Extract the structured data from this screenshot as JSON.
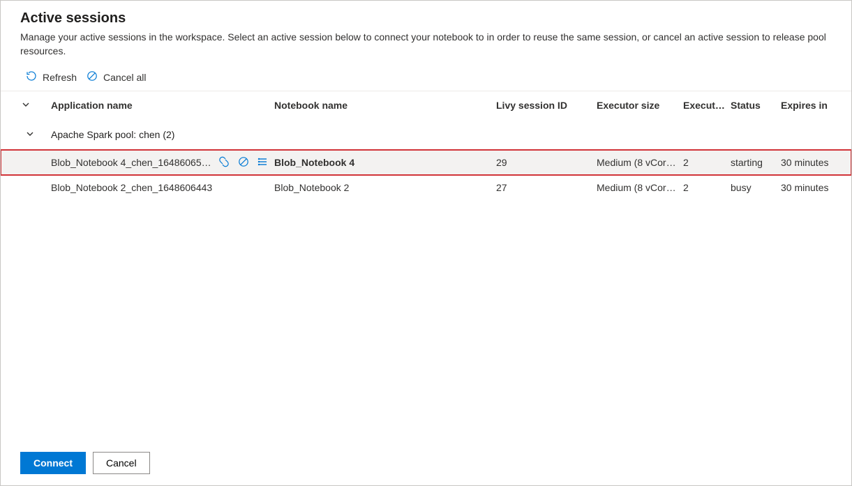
{
  "header": {
    "title": "Active sessions",
    "description": "Manage your active sessions in the workspace. Select an active session below to connect your notebook to in order to reuse the same session, or cancel an active session to release pool resources."
  },
  "toolbar": {
    "refresh": "Refresh",
    "cancel_all": "Cancel all"
  },
  "columns": {
    "app_name": "Application name",
    "notebook_name": "Notebook name",
    "livy_id": "Livy session ID",
    "executor_size": "Executor size",
    "executor_count": "Execut…",
    "status": "Status",
    "expires_in": "Expires in"
  },
  "group": {
    "label": "Apache Spark pool: chen (2)"
  },
  "sessions": [
    {
      "app_name": "Blob_Notebook 4_chen_16486065…",
      "notebook_name": "Blob_Notebook 4",
      "livy_id": "29",
      "executor_size": "Medium (8 vCor…",
      "executor_count": "2",
      "status": "starting",
      "expires_in": "30 minutes",
      "selected": true
    },
    {
      "app_name": "Blob_Notebook 2_chen_1648606443",
      "notebook_name": "Blob_Notebook 2",
      "livy_id": "27",
      "executor_size": "Medium (8 vCor…",
      "executor_count": "2",
      "status": "busy",
      "expires_in": "30 minutes",
      "selected": false
    }
  ],
  "footer": {
    "connect": "Connect",
    "cancel": "Cancel"
  }
}
